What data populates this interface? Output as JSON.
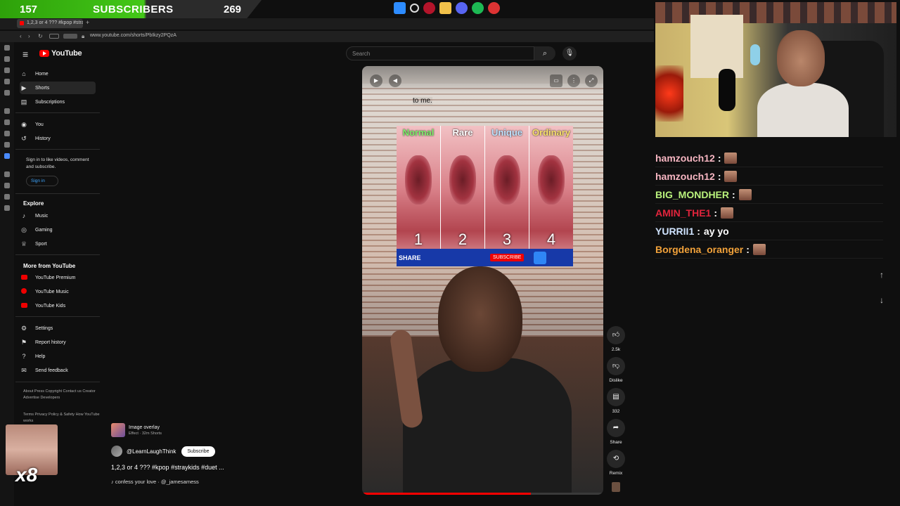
{
  "overlay": {
    "sub_count": "157",
    "sub_label": "SUBSCRIBERS",
    "sub_goal": "269",
    "emote_multiplier": "x8"
  },
  "browser": {
    "tab_title": "1,2,3 or 4 ??? #kpop #strayki",
    "url": "www.youtube.com/shorts/PbIkzy2PQzA"
  },
  "youtube": {
    "logo_text": "YouTube",
    "search_placeholder": "Search",
    "sidebar": {
      "main": [
        {
          "label": "Home",
          "icon": "home-icon"
        },
        {
          "label": "Shorts",
          "icon": "shorts-icon"
        },
        {
          "label": "Subscriptions",
          "icon": "subscriptions-icon"
        }
      ],
      "you": [
        {
          "label": "You",
          "icon": "you-icon"
        },
        {
          "label": "History",
          "icon": "history-icon"
        }
      ],
      "signin_prompt": "Sign in to like videos, comment and subscribe.",
      "signin_button": "Sign in",
      "explore_heading": "Explore",
      "explore": [
        {
          "label": "Music",
          "icon": "music-icon"
        },
        {
          "label": "Gaming",
          "icon": "gaming-icon"
        },
        {
          "label": "Sport",
          "icon": "trophy-icon"
        }
      ],
      "more_heading": "More from YouTube",
      "more": [
        {
          "label": "YouTube Premium"
        },
        {
          "label": "YouTube Music"
        },
        {
          "label": "YouTube Kids"
        }
      ],
      "settings": [
        {
          "label": "Settings",
          "icon": "gear-icon"
        },
        {
          "label": "Report history",
          "icon": "flag-icon"
        },
        {
          "label": "Help",
          "icon": "help-icon"
        },
        {
          "label": "Send feedback",
          "icon": "feedback-icon"
        }
      ],
      "footer1": "About  Press  Copyright  Contact us  Creator  Advertise  Developers",
      "footer2": "Terms  Privacy  Policy & Safety  How YouTube works"
    },
    "short": {
      "caption": "to me.",
      "grid_labels": [
        "Normal",
        "Rare",
        "Unique",
        "Ordinary"
      ],
      "grid_numbers": [
        "1",
        "2",
        "3",
        "4"
      ],
      "share_text": "SHARE",
      "subscribe_text": "SUBSCRIBE",
      "progress": 0.7
    },
    "actions": {
      "like_count": "2.5k",
      "dislike_label": "Dislike",
      "comment_count": "332",
      "share_label": "Share",
      "remix_label": "Remix"
    },
    "info": {
      "effect_title": "Image overlay",
      "effect_sub": "Effect · 32m Shorts",
      "channel": "@LearnLaughThink",
      "subscribe": "Subscribe",
      "title": "1,2,3 or 4 ??? #kpop #straykids #duet ...",
      "music": "♪ confess your love · @_jamesamess"
    }
  },
  "chat": [
    {
      "user": "hamzouch12",
      "color": "#f7b6c2",
      "msg": ""
    },
    {
      "user": "hamzouch12",
      "color": "#f7b6c2",
      "msg": ""
    },
    {
      "user": "BIG_MONDHER",
      "color": "#b9f27c",
      "msg": ""
    },
    {
      "user": "AMIN_THE1",
      "color": "#e0243c",
      "msg": ""
    },
    {
      "user": "YURRII1",
      "color": "#cfe3ff",
      "msg": "ay yo"
    },
    {
      "user": "Borgdena_oranger",
      "color": "#f2a23a",
      "msg": ""
    }
  ]
}
